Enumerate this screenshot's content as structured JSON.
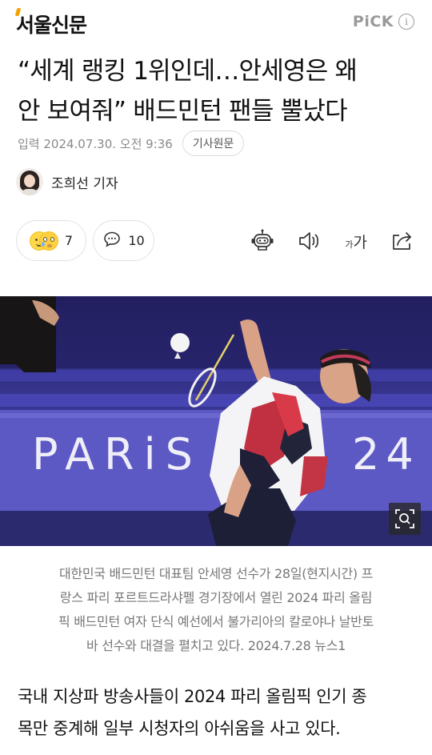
{
  "header": {
    "logo_text": "서울신문",
    "pick_label": "PiCK",
    "info_icon": "info-icon"
  },
  "article": {
    "headline_line1": "“세계 랭킹 1위인데…안세영은 왜",
    "headline_line2": "안 보여줘” 배드민턴 팬들 뿔났다",
    "date": "입력 2024.07.30. 오전 9:36",
    "original_button": "기사원문",
    "reporter": "조희선 기자",
    "reaction_count": "7",
    "comment_count": "10",
    "font_size_small": "가",
    "font_size_big": "가",
    "photo_banner_text": "PARiS",
    "photo_banner_number": "24",
    "caption_line1": "대한민국 배드민턴 대표팀 안세영 선수가 28일(현지시간) 프",
    "caption_line2": "랑스 파리 포르트드라샤펠 경기장에서 열린 2024 파리 올림",
    "caption_line3": "픽 배드민턴 여자 단식 예선에서 불가리아의 칼로야나 날반토",
    "caption_line4": "바 선수와 대결을 펼치고 있다. 2024.7.28 뉴스1",
    "body_line1": "국내 지상파 방송사들이 2024 파리 올림픽 인기 종",
    "body_line2": "목만 중계해 일부 시청자의 아쉬움을 사고 있다."
  },
  "colors": {
    "logo_accent": "#f2a100",
    "photo_background": "#2b2a78",
    "caption_text": "#777777"
  },
  "icons": [
    "reaction-emoji-icon",
    "comment-icon",
    "robot-summary-icon",
    "speaker-icon",
    "font-size-icon",
    "share-icon",
    "zoom-icon"
  ]
}
